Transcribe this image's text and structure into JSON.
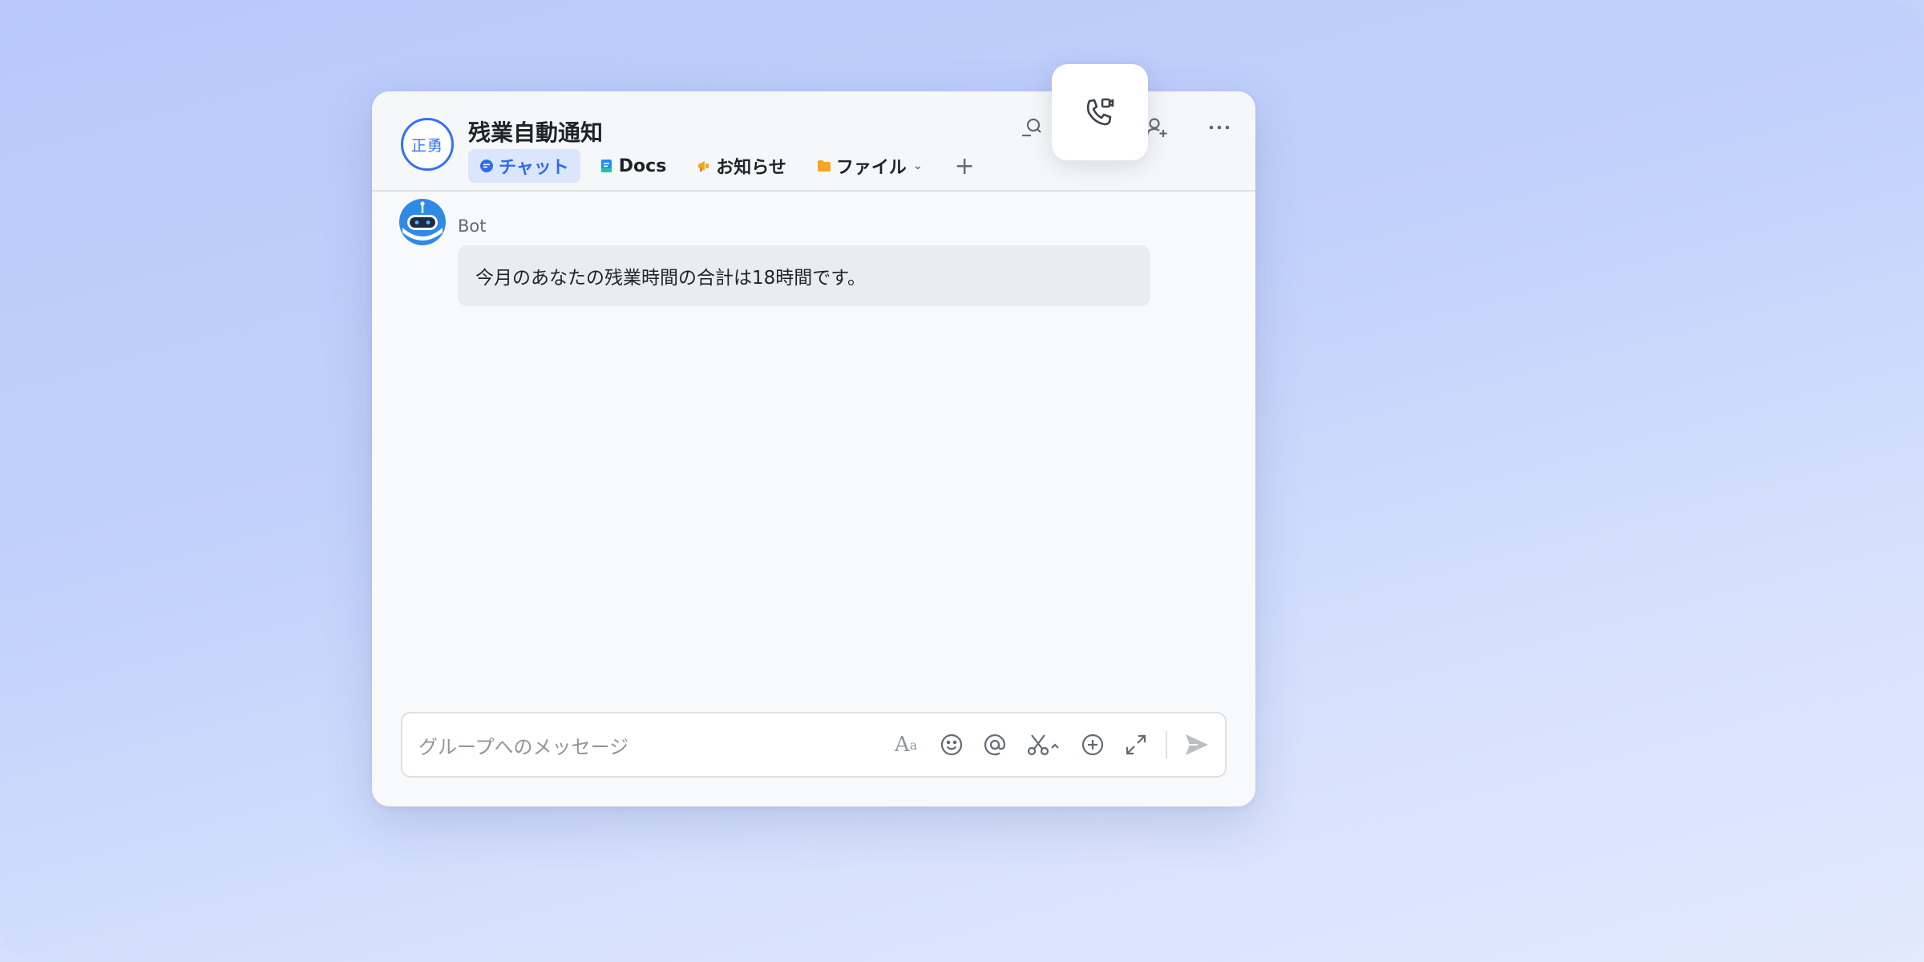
{
  "group": {
    "avatar_text": "正勇",
    "title": "残業自動通知"
  },
  "tabs": [
    {
      "label": "チャット",
      "active": true,
      "icon": "chat-bubble-icon",
      "color": "#2f6bef"
    },
    {
      "label": "Docs",
      "active": false,
      "icon": "doc-icon",
      "color": "#1f8ef1"
    },
    {
      "label": "お知らせ",
      "active": false,
      "icon": "megaphone-icon",
      "color": "#f5a623"
    },
    {
      "label": "ファイル",
      "active": false,
      "icon": "folder-icon",
      "color": "#f5a623"
    }
  ],
  "tab_add_label": "+",
  "header_icons": [
    "search-member-icon",
    "add-member-icon",
    "more-icon"
  ],
  "call_popup_icon": "video-call-icon",
  "message": {
    "sender": "Bot",
    "text": "今月のあなたの残業時間の合計は18時間です。"
  },
  "composer": {
    "placeholder": "グループへのメッセージ"
  },
  "colors": {
    "accent": "#3370ff",
    "window_bg": "#f8f9fb",
    "bubble_bg": "#ebecee"
  }
}
